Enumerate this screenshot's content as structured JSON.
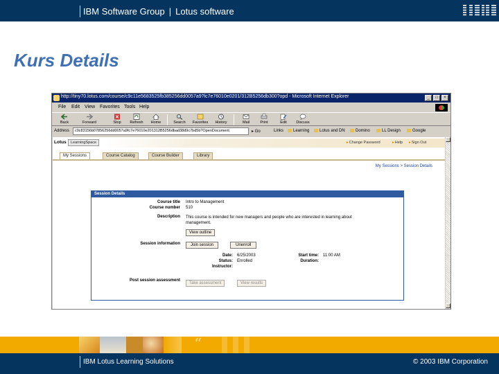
{
  "slide": {
    "header_left": "IBM Software Group",
    "header_sep": "|",
    "header_right": "Lotus software",
    "title": "Kurs Details",
    "footer_left": "IBM Lotus Learning Solutions",
    "footer_right": "© 2003 IBM Corporation"
  },
  "browser": {
    "title": "http://tiny70.lotus.com/course/c9c11e5683525fb385256dd0057a9?lc7e76010e0201/312B5256db300?opd - Microsoft Internet Explorer",
    "menu": [
      "File",
      "Edit",
      "View",
      "Favorites",
      "Tools",
      "Help"
    ],
    "toolbar": [
      {
        "label": "Back",
        "icon": "back-arrow-icon"
      },
      {
        "label": "Forward",
        "icon": "forward-arrow-icon"
      },
      {
        "label": "Stop",
        "icon": "stop-icon"
      },
      {
        "label": "Refresh",
        "icon": "refresh-icon"
      },
      {
        "label": "Home",
        "icon": "home-icon"
      },
      {
        "label": "Search",
        "icon": "search-icon"
      },
      {
        "label": "Favorites",
        "icon": "favorites-icon"
      },
      {
        "label": "History",
        "icon": "history-icon"
      },
      {
        "label": "Mail",
        "icon": "mail-icon"
      },
      {
        "label": "Print",
        "icon": "print-icon"
      },
      {
        "label": "Edit",
        "icon": "edit-icon"
      },
      {
        "label": "Discuss",
        "icon": "discuss-icon"
      }
    ],
    "address_label": "Address",
    "address_value": "c9c83156b07856256dd0057a9fc7e76010e201312B5256dbad38d9c7bd5b?OpenDocument",
    "go_label": "Go",
    "links_label": "Links",
    "links": [
      "Learning",
      "Lotus and DN",
      "Domino",
      "LL Design",
      "Google"
    ]
  },
  "lms": {
    "brand": "Lotus",
    "product": "LearningSpace",
    "top_links": [
      "Change Password",
      "Help",
      "Sign Out"
    ],
    "tabs": [
      "My Sessions",
      "Course Catalog",
      "Course Builder",
      "Library"
    ],
    "active_tab": "My Sessions",
    "breadcrumb": "My Sessions > Session Details",
    "panel_title": "Session Details",
    "labels": {
      "course_title": "Course title",
      "course_number": "Course number",
      "description": "Description",
      "session_information": "Session information",
      "date": "Date:",
      "status": "Status:",
      "instructor": "Instructor:",
      "start_time": "Start time:",
      "duration": "Duration:",
      "post_session_assessment": "Post session assessment"
    },
    "values": {
      "course_title": "Intro to Management",
      "course_number": "510",
      "description": "This course is intended for new managers and people who are interested in learning about management.",
      "date": "6/25/2003",
      "status": "Enrolled",
      "instructor": "",
      "start_time": "11:00 AM",
      "duration": ""
    },
    "buttons": {
      "view_outline": "View outline",
      "join_session": "Join session",
      "unenroll": "Unenroll",
      "take_assessment": "Take assessment",
      "view_results": "View results"
    }
  },
  "colors": {
    "header_navy": "#05345f",
    "title_blue": "#3f6fb4",
    "footer_band": "#f2a900",
    "panel_blue": "#2f5aa0"
  }
}
